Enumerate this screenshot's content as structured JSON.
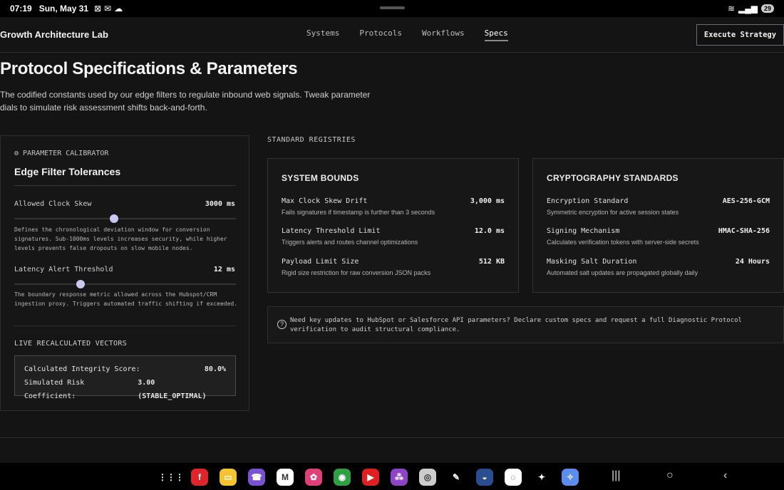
{
  "statusbar": {
    "time": "07:19",
    "date": "Sun, May 31",
    "battery": "29"
  },
  "nav": {
    "brand": "Growth Architecture Lab",
    "links": [
      "Systems",
      "Protocols",
      "Workflows",
      "Specs"
    ],
    "active": "Specs",
    "cta": "Execute Strategy"
  },
  "header": {
    "title": "Protocol Specifications & Parameters",
    "description": "The codified constants used by our edge filters to regulate inbound web signals. Tweak parameter dials to simulate risk assessment shifts back-and-forth."
  },
  "calibrator": {
    "tag": "PARAMETER CALIBRATOR",
    "title": "Edge Filter Tolerances",
    "params": [
      {
        "label": "Allowed Clock Skew",
        "value": "3000 ms",
        "level": 0.45,
        "description": "Defines the chronological deviation window for conversion signatures. Sub-1000ms levels increases security, while higher levels prevents false dropouts on slow mobile nodes."
      },
      {
        "label": "Latency Alert Threshold",
        "value": "12 ms",
        "level": 0.3,
        "description": "The boundary response metric allowed across the Hubspot/CRM ingestion proxy. Triggers automated traffic shifting if exceeded."
      }
    ],
    "vectors": {
      "title": "LIVE RECALCULATED VECTORS",
      "rows": [
        {
          "label": "Calculated Integrity Score:",
          "value": "80.0%"
        },
        {
          "label": "Simulated Risk Coefficient:",
          "value": "3.00 (STABLE_OPTIMAL)"
        }
      ]
    }
  },
  "registries": {
    "title": "STANDARD REGISTRIES",
    "cards": [
      {
        "title": "SYSTEM BOUNDS",
        "rows": [
          {
            "key": "Max Clock Skew Drift",
            "value": "3,000 ms",
            "desc": "Fails signatures if timestamp is further than 3 seconds"
          },
          {
            "key": "Latency Threshold Limit",
            "value": "12.0 ms",
            "desc": "Triggers alerts and routes channel optimizations"
          },
          {
            "key": "Payload Limit Size",
            "value": "512 KB",
            "desc": "Rigid size restriction for raw conversion JSON packs"
          }
        ]
      },
      {
        "title": "CRYPTOGRAPHY STANDARDS",
        "rows": [
          {
            "key": "Encryption Standard",
            "value": "AES-256-GCM",
            "desc": "Symmetric encryption for active session states"
          },
          {
            "key": "Signing Mechanism",
            "value": "HMAC-SHA-256",
            "desc": "Calculates verification tokens with server-side secrets"
          },
          {
            "key": "Masking Salt Duration",
            "value": "24 Hours",
            "desc": "Automated salt updates are propagated globally daily"
          }
        ]
      }
    ],
    "notice": "Need key updates to HubSpot or Salesforce API parameters? Declare custom specs and request a full Diagnostic Protocol verification to audit structural compliance."
  },
  "dock": {
    "apps": [
      {
        "name": "app-drawer-icon",
        "color": "#000000",
        "glyph": "⋮⋮⋮"
      },
      {
        "name": "flipboard-icon",
        "color": "#e0242b",
        "glyph": "f"
      },
      {
        "name": "notes-icon",
        "color": "#f4c430",
        "glyph": "▭"
      },
      {
        "name": "viber-icon",
        "color": "#7b51d3",
        "glyph": "☎"
      },
      {
        "name": "gmail-icon",
        "color": "#ffffff",
        "glyph": "M"
      },
      {
        "name": "photos-icon",
        "color": "#e0407a",
        "glyph": "✿"
      },
      {
        "name": "chrome-icon",
        "color": "#2f9e44",
        "glyph": "◉"
      },
      {
        "name": "youtube-icon",
        "color": "#e02020",
        "glyph": "▶"
      },
      {
        "name": "apps-icon",
        "color": "#8e44c8",
        "glyph": "⁂"
      },
      {
        "name": "camera-icon",
        "color": "#cccccc",
        "glyph": "◎"
      },
      {
        "name": "edit-icon",
        "color": "#000000",
        "glyph": "✎"
      },
      {
        "name": "game-icon",
        "color": "#2a4d8f",
        "glyph": "◒"
      },
      {
        "name": "signal-icon",
        "color": "#ffffff",
        "glyph": "◌"
      },
      {
        "name": "sparkle-icon",
        "color": "#000000",
        "glyph": "✦"
      },
      {
        "name": "assistant-icon",
        "color": "#5a8dee",
        "glyph": "✧"
      }
    ]
  }
}
